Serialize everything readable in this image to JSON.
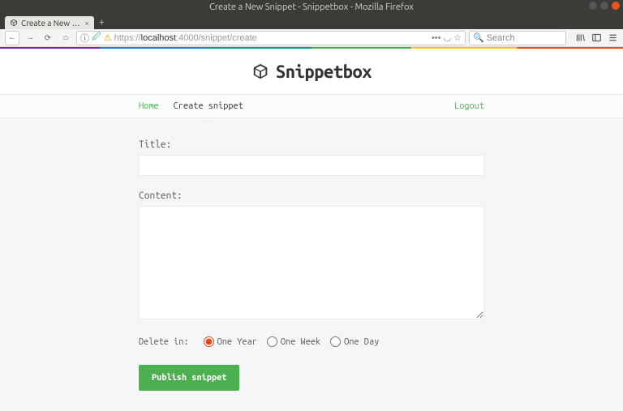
{
  "window": {
    "title": "Create a New Snippet - Snippetbox - Mozilla Firefox"
  },
  "tab": {
    "label": "Create a New Snippe"
  },
  "url": {
    "protocol": "https://",
    "host": "localhost",
    "port_path": ":4000/snippet/create"
  },
  "search": {
    "placeholder": "Search"
  },
  "brand": {
    "name": "Snippetbox"
  },
  "nav": {
    "home": "Home",
    "create": "Create snippet",
    "logout": "Logout"
  },
  "form": {
    "title_label": "Title:",
    "title_value": "",
    "content_label": "Content:",
    "content_value": "",
    "delete_label": "Delete in:",
    "options": {
      "year": "One Year",
      "week": "One Week",
      "day": "One Day"
    },
    "selected": "year",
    "submit": "Publish snippet"
  }
}
